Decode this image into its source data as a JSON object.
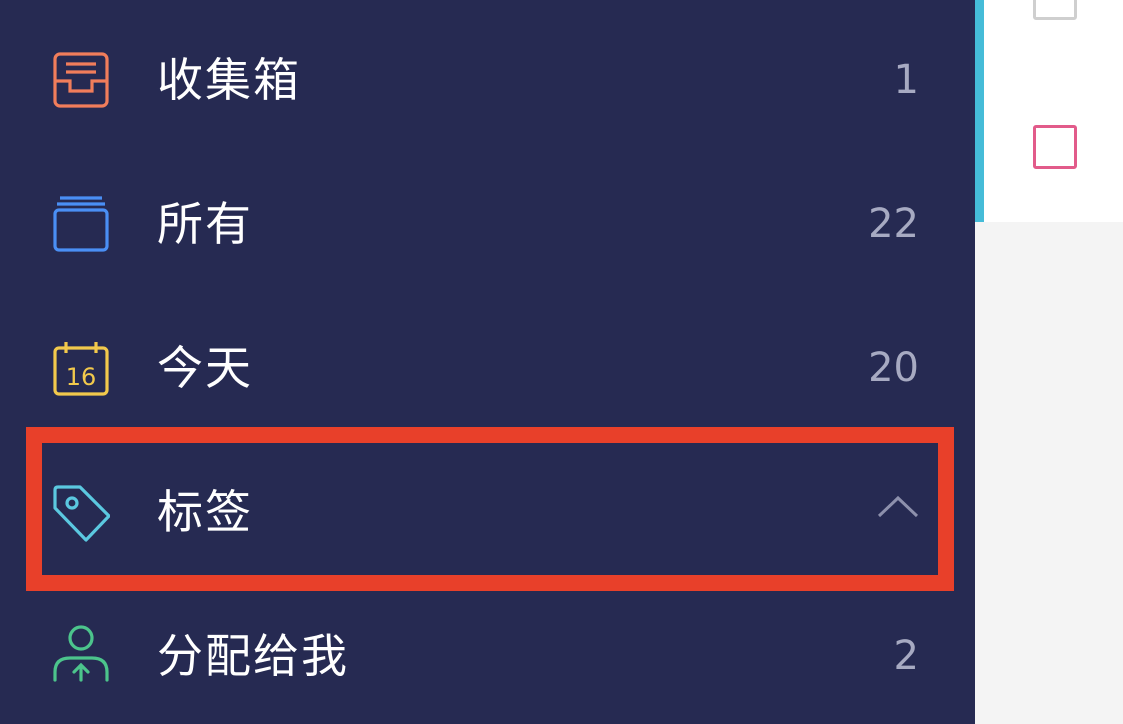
{
  "sidebar": {
    "items": [
      {
        "name": "inbox",
        "label": "收集箱",
        "count": "1",
        "icon": "inbox-tray-icon",
        "color": "#f17d5b"
      },
      {
        "name": "all",
        "label": "所有",
        "count": "22",
        "icon": "stacked-cards-icon",
        "color": "#4a8ff5"
      },
      {
        "name": "today",
        "label": "今天",
        "count": "20",
        "icon": "calendar-icon",
        "icon_text": "16",
        "color": "#f2c94c"
      },
      {
        "name": "tags",
        "label": "标签",
        "icon": "tag-icon",
        "toggle_icon": "chevron-up-icon",
        "color": "#5bc8e0"
      },
      {
        "name": "assigned",
        "label": "分配给我",
        "count": "2",
        "icon": "assigned-user-icon",
        "color": "#4cc48c"
      }
    ]
  },
  "task_panel": {
    "checkboxes": [
      {
        "state": "unchecked",
        "color": "#cfcfcf"
      },
      {
        "state": "unchecked",
        "color": "#e25b8a"
      }
    ]
  },
  "colors": {
    "sidebar_bg": "#262a52",
    "highlight": "#e8402a",
    "accent": "#45bcd8"
  }
}
